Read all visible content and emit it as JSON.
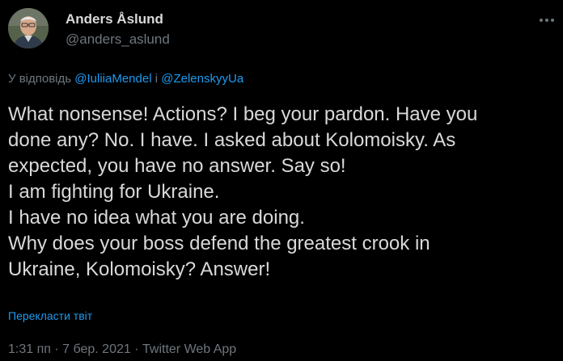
{
  "author": {
    "name": "Anders Åslund",
    "handle": "@anders_aslund",
    "avatar_icon": "person-avatar"
  },
  "more_icon": "more-horizontal-icon",
  "reply": {
    "prefix": "У відповідь",
    "mention1": "@IuliiaMendel",
    "conjunction": "і",
    "mention2": "@ZelenskyyUa"
  },
  "tweet_lines": [
    "What nonsense! Actions? I beg your pardon. Have you",
    "done any? No. I have. I asked about Kolomoisky. As",
    "expected, you have no answer. Say so!",
    "I am fighting for Ukraine.",
    "I have no idea what you are doing.",
    "Why does your boss defend the greatest crook in",
    "Ukraine, Kolomoisky? Answer!"
  ],
  "translate_label": "Перекласти твіт",
  "meta": {
    "time": "1:31 пп",
    "separator": "·",
    "date": "7 бер. 2021",
    "source": "Twitter Web App"
  },
  "colors": {
    "background": "#000000",
    "text": "#d9d9d9",
    "secondary": "#6e767d",
    "link": "#1d9bf0"
  }
}
